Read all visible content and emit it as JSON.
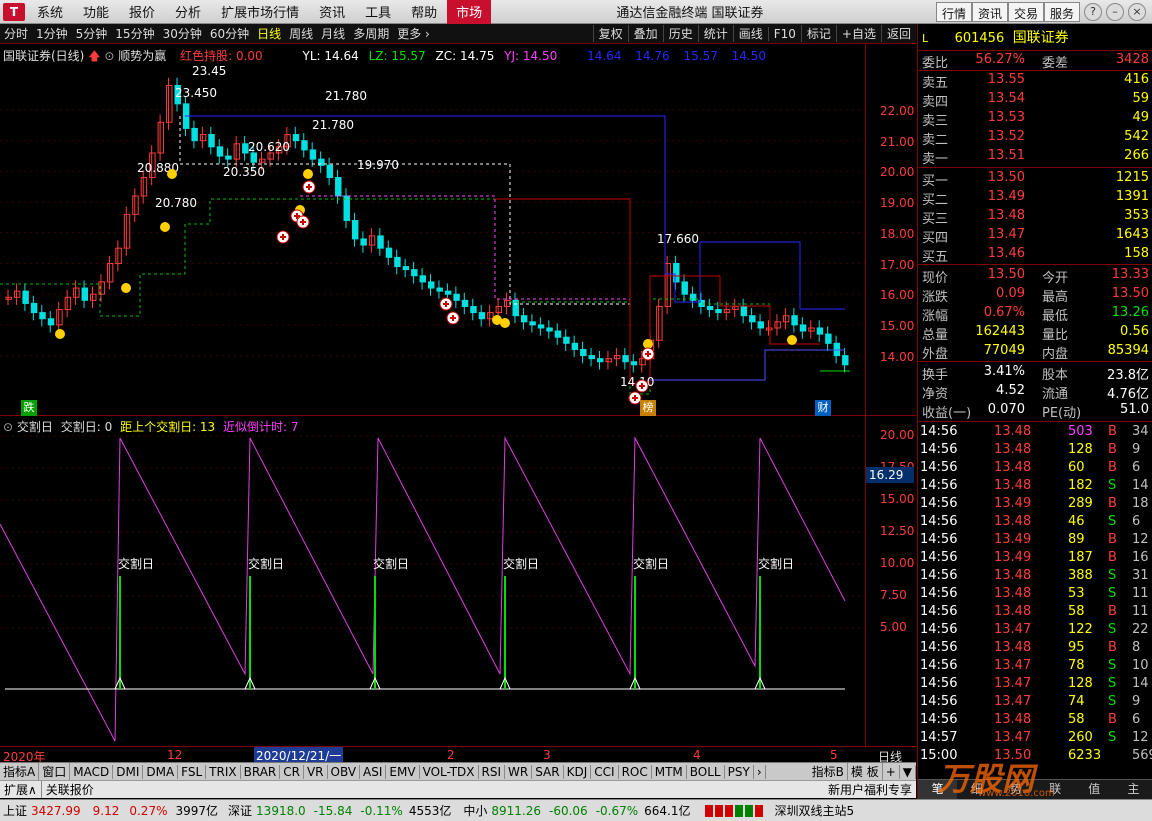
{
  "menu": {
    "logo": "T",
    "items": [
      "系统",
      "功能",
      "报价",
      "分析",
      "扩展市场行情",
      "资讯",
      "工具",
      "帮助",
      "市场"
    ],
    "title": "通达信金融终端  国联证券",
    "right_buttons": [
      "行情",
      "资讯",
      "交易",
      "服务"
    ]
  },
  "periods": {
    "items": [
      "分时",
      "1分钟",
      "5分钟",
      "15分钟",
      "30分钟",
      "60分钟",
      "日线",
      "周线",
      "月线",
      "多周期",
      "更多 ›"
    ],
    "selected": "日线",
    "right": [
      "复权",
      "叠加",
      "历史",
      "统计",
      "画线",
      "F10",
      "标记",
      "+自选",
      "返回"
    ]
  },
  "main_chart": {
    "title": "国联证券(日线)",
    "indicator_name": "顺势为赢",
    "hold_label": "红色持股: 0.00",
    "yl": "YL: 14.64",
    "lz": "LZ: 15.57",
    "zc": "ZC: 14.75",
    "yj": "YJ: 14.50",
    "extra_values": [
      "14.64",
      "14.76",
      "15.57",
      "14.50"
    ],
    "y_labels": [
      "22.00",
      "21.00",
      "20.00",
      "19.00",
      "18.00",
      "17.00",
      "16.00",
      "15.00",
      "14.00"
    ],
    "annotations": [
      "23.45",
      "23.450",
      "21.780",
      "21.780",
      "20.620",
      "20.880",
      "20.350",
      "20.780",
      "19.970",
      "17.660",
      "14.10"
    ],
    "badges": {
      "die": "跌",
      "bang": "榜",
      "cai": "财"
    }
  },
  "sub_chart": {
    "title": "交割日",
    "v1": "交割日: 0",
    "v2": "距上个交割日: 13",
    "v3": "近似倒计时: 7",
    "current": "16.29",
    "y_labels": [
      "20.00",
      "17.50",
      "15.00",
      "12.50",
      "10.00",
      "7.50",
      "5.00"
    ],
    "event_label": "交割日"
  },
  "x_axis": {
    "labels": [
      "2020年",
      "12",
      "2020/12/21/一",
      "2",
      "3",
      "4",
      "5"
    ],
    "right": "日线"
  },
  "indicator_tabs": {
    "items": [
      "指标A",
      "窗口",
      "MACD",
      "DMI",
      "DMA",
      "FSL",
      "TRIX",
      "BRAR",
      "CR",
      "VR",
      "OBV",
      "ASI",
      "EMV",
      "VOL-TDX",
      "RSI",
      "WR",
      "SAR",
      "KDJ",
      "CCI",
      "ROC",
      "MTM",
      "BOLL",
      "PSY"
    ],
    "right": [
      "指标B",
      "模 板",
      "+",
      "▼"
    ]
  },
  "ext_bar": {
    "left": [
      "扩展∧",
      "关联报价"
    ],
    "right": "新用户福利专享"
  },
  "status": {
    "sh_name": "上证",
    "sh_val": "3427.99",
    "sh_chg": "9.12",
    "sh_pct": "0.27%",
    "sh_amt": "3997亿",
    "sz_name": "深证",
    "sz_val": "13918.0",
    "sz_chg": "-15.84",
    "sz_pct": "-0.11%",
    "sz_amt": "4553亿",
    "zx_name": "中小",
    "zx_val": "8911.26",
    "zx_chg": "-60.06",
    "zx_pct": "-0.67%",
    "zx_amt": "664.1亿",
    "server": "深圳双线主站5"
  },
  "quote": {
    "code": "601456",
    "name": "国联证券",
    "ratio_label": "委比",
    "ratio": "56.27%",
    "diff_label": "委差",
    "diff": "3428",
    "asks": [
      {
        "label": "卖五",
        "price": "13.55",
        "vol": "416"
      },
      {
        "label": "卖四",
        "price": "13.54",
        "vol": "59"
      },
      {
        "label": "卖三",
        "price": "13.53",
        "vol": "49"
      },
      {
        "label": "卖二",
        "price": "13.52",
        "vol": "542"
      },
      {
        "label": "卖一",
        "price": "13.51",
        "vol": "266"
      }
    ],
    "bids": [
      {
        "label": "买一",
        "price": "13.50",
        "vol": "1215"
      },
      {
        "label": "买二",
        "price": "13.49",
        "vol": "1391"
      },
      {
        "label": "买三",
        "price": "13.48",
        "vol": "353"
      },
      {
        "label": "买四",
        "price": "13.47",
        "vol": "1643"
      },
      {
        "label": "买五",
        "price": "13.46",
        "vol": "158"
      }
    ],
    "stats": [
      {
        "l1": "现价",
        "v1": "13.50",
        "l2": "今开",
        "v2": "13.33"
      },
      {
        "l1": "涨跌",
        "v1": "0.09",
        "l2": "最高",
        "v2": "13.50"
      },
      {
        "l1": "涨幅",
        "v1": "0.67%",
        "l2": "最低",
        "v2": "13.26"
      },
      {
        "l1": "总量",
        "v1": "162443",
        "l2": "量比",
        "v2": "0.56"
      },
      {
        "l1": "外盘",
        "v1": "77049",
        "l2": "内盘",
        "v2": "85394"
      }
    ],
    "stats2": [
      {
        "l1": "换手",
        "v1": "3.41%",
        "l2": "股本",
        "v2": "23.8亿"
      },
      {
        "l1": "净资",
        "v1": "4.52",
        "l2": "流通",
        "v2": "4.76亿"
      },
      {
        "l1": "收益(一)",
        "v1": "0.070",
        "l2": "PE(动)",
        "v2": "51.0"
      }
    ],
    "ticks": [
      {
        "t": "14:56",
        "p": "13.48",
        "v": "503",
        "d": "B",
        "n": "34"
      },
      {
        "t": "14:56",
        "p": "13.48",
        "v": "128",
        "d": "B",
        "n": "9"
      },
      {
        "t": "14:56",
        "p": "13.48",
        "v": "60",
        "d": "B",
        "n": "6"
      },
      {
        "t": "14:56",
        "p": "13.48",
        "v": "182",
        "d": "S",
        "n": "14"
      },
      {
        "t": "14:56",
        "p": "13.49",
        "v": "289",
        "d": "B",
        "n": "18"
      },
      {
        "t": "14:56",
        "p": "13.48",
        "v": "46",
        "d": "S",
        "n": "6"
      },
      {
        "t": "14:56",
        "p": "13.49",
        "v": "89",
        "d": "B",
        "n": "12"
      },
      {
        "t": "14:56",
        "p": "13.49",
        "v": "187",
        "d": "B",
        "n": "16"
      },
      {
        "t": "14:56",
        "p": "13.48",
        "v": "388",
        "d": "S",
        "n": "31"
      },
      {
        "t": "14:56",
        "p": "13.48",
        "v": "53",
        "d": "S",
        "n": "11"
      },
      {
        "t": "14:56",
        "p": "13.48",
        "v": "58",
        "d": "B",
        "n": "11"
      },
      {
        "t": "14:56",
        "p": "13.47",
        "v": "122",
        "d": "S",
        "n": "22"
      },
      {
        "t": "14:56",
        "p": "13.48",
        "v": "95",
        "d": "B",
        "n": "8"
      },
      {
        "t": "14:56",
        "p": "13.47",
        "v": "78",
        "d": "S",
        "n": "10"
      },
      {
        "t": "14:56",
        "p": "13.47",
        "v": "128",
        "d": "S",
        "n": "14"
      },
      {
        "t": "14:56",
        "p": "13.47",
        "v": "74",
        "d": "S",
        "n": "9"
      },
      {
        "t": "14:56",
        "p": "13.48",
        "v": "58",
        "d": "B",
        "n": "6"
      },
      {
        "t": "14:57",
        "p": "13.47",
        "v": "260",
        "d": "S",
        "n": "12"
      },
      {
        "t": "15:00",
        "p": "13.50",
        "v": "6233",
        "d": "",
        "n": "569"
      }
    ],
    "bottom_tabs": [
      "笔",
      "细",
      "势",
      "联",
      "值",
      "主"
    ]
  },
  "watermark": {
    "text": "万股网",
    "url": "www.2010.com"
  }
}
